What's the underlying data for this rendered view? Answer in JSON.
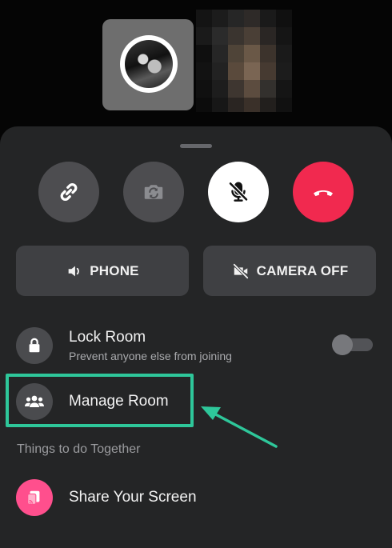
{
  "controls": {
    "icons": [
      "link-icon",
      "camera-flip-icon",
      "mic-off-icon",
      "end-call-icon"
    ]
  },
  "audio_button": {
    "label": "PHONE",
    "icon": "speaker-icon"
  },
  "camera_button": {
    "label": "CAMERA OFF",
    "icon": "camera-off-icon"
  },
  "lock_room": {
    "title": "Lock Room",
    "subtitle": "Prevent anyone else from joining",
    "enabled": false
  },
  "manage_room": {
    "title": "Manage Room"
  },
  "section": {
    "label": "Things to do Together"
  },
  "share_screen": {
    "title": "Share Your Screen"
  },
  "colors": {
    "sheet": "#242526",
    "end_call": "#f1294f",
    "highlight": "#2ec79a",
    "share_icon_bg": "#ff4f8d"
  }
}
